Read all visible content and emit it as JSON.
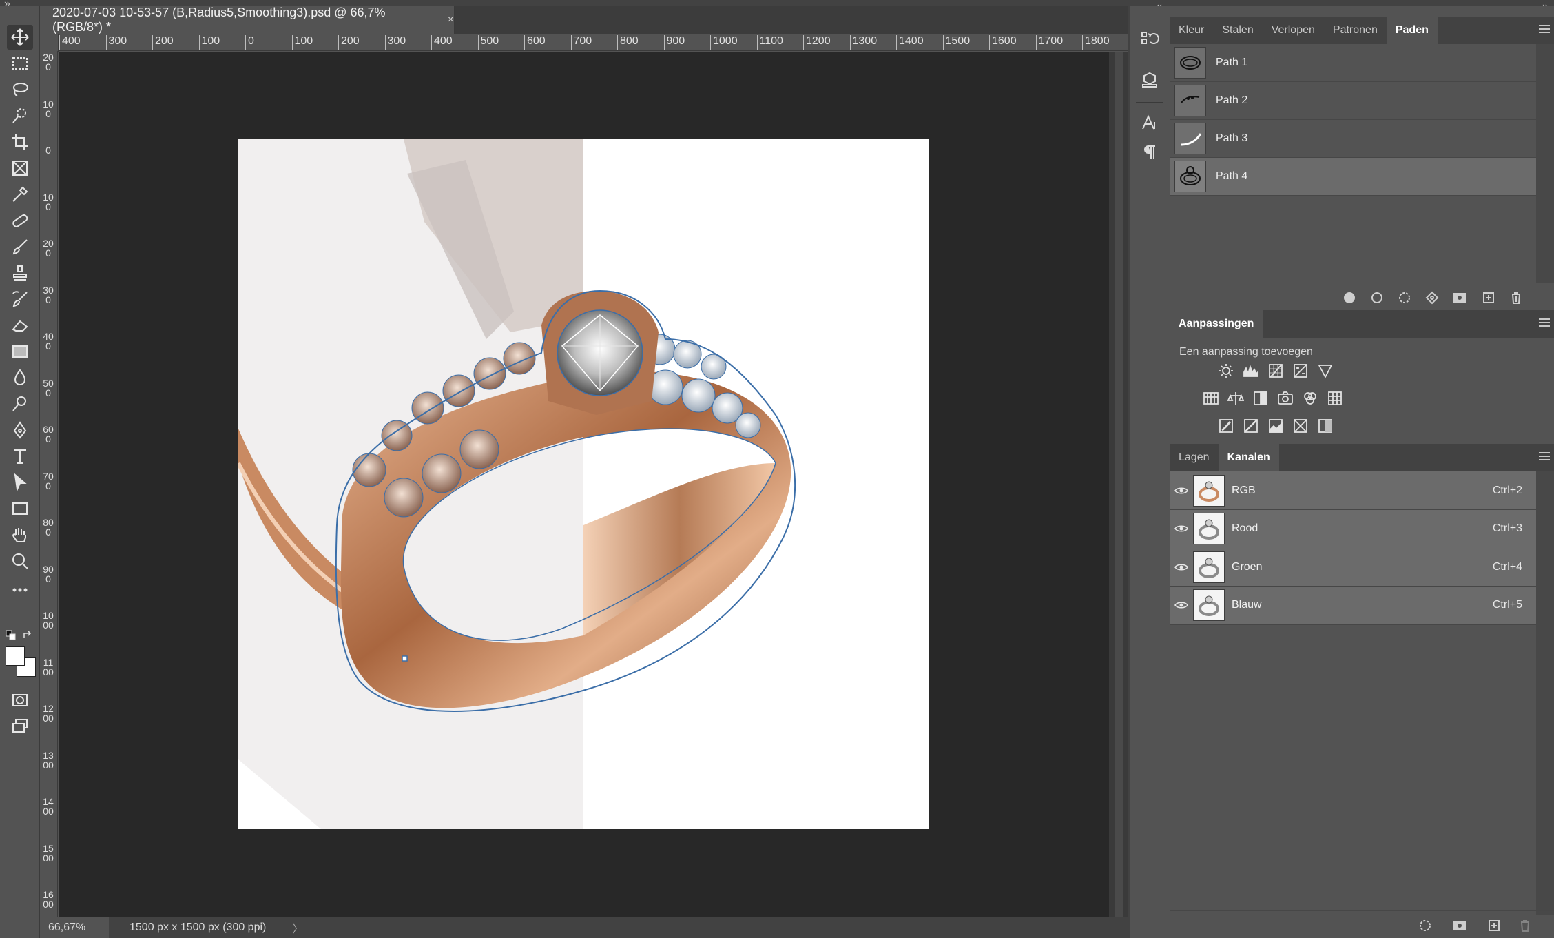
{
  "document": {
    "tab_title": "2020-07-03 10-53-57 (B,Radius5,Smoothing3).psd @ 66,7% (RGB/8*) *",
    "close_glyph": "×"
  },
  "ruler": {
    "horizontal": [
      "400",
      "300",
      "200",
      "100",
      "0",
      "100",
      "200",
      "300",
      "400",
      "500",
      "600",
      "700",
      "800",
      "900",
      "1000",
      "1100",
      "1200",
      "1300",
      "1400",
      "1500",
      "1600",
      "1700",
      "1800"
    ],
    "vertical": [
      "200",
      "100",
      "0",
      "100",
      "200",
      "300",
      "400",
      "500",
      "600",
      "700",
      "800",
      "900",
      "1000",
      "1100",
      "1200",
      "1300",
      "1400",
      "1500",
      "1600"
    ]
  },
  "status": {
    "zoom": "66,67%",
    "doc_size": "1500 px x 1500 px (300 ppi)",
    "arrow": "〉"
  },
  "toolbar": {
    "tools": [
      "move-tool",
      "marquee-tool",
      "lasso-tool",
      "quick-selection-tool",
      "crop-tool",
      "frame-tool",
      "eyedropper-tool",
      "healing-brush-tool",
      "brush-tool",
      "clone-stamp-tool",
      "history-brush-tool",
      "eraser-tool",
      "gradient-tool",
      "blur-tool",
      "dodge-tool",
      "pen-tool",
      "type-tool",
      "path-selection-tool",
      "rectangle-tool",
      "hand-tool",
      "zoom-tool",
      "more-tools"
    ],
    "colors": {
      "foreground": "#ffffff",
      "background": "#ffffff"
    }
  },
  "paths_panel": {
    "tabs": [
      "Kleur",
      "Stalen",
      "Verlopen",
      "Patronen",
      "Paden"
    ],
    "active_tab": "Paden",
    "paths": [
      {
        "name": "Path 1",
        "selected": false
      },
      {
        "name": "Path 2",
        "selected": false
      },
      {
        "name": "Path 3",
        "selected": false
      },
      {
        "name": "Path 4",
        "selected": true
      }
    ]
  },
  "adjustments_panel": {
    "tab": "Aanpassingen",
    "subtitle": "Een aanpassing toevoegen"
  },
  "channels_panel": {
    "tabs": [
      "Lagen",
      "Kanalen"
    ],
    "active_tab": "Kanalen",
    "channels": [
      {
        "name": "RGB",
        "shortcut": "Ctrl+2"
      },
      {
        "name": "Rood",
        "shortcut": "Ctrl+3"
      },
      {
        "name": "Groen",
        "shortcut": "Ctrl+4"
      },
      {
        "name": "Blauw",
        "shortcut": "Ctrl+5"
      }
    ]
  },
  "colors": {
    "app_bg": "#535353",
    "pasteboard": "#282828",
    "ring_gold": "#c98a62",
    "path_outline": "#3b6ea8"
  }
}
